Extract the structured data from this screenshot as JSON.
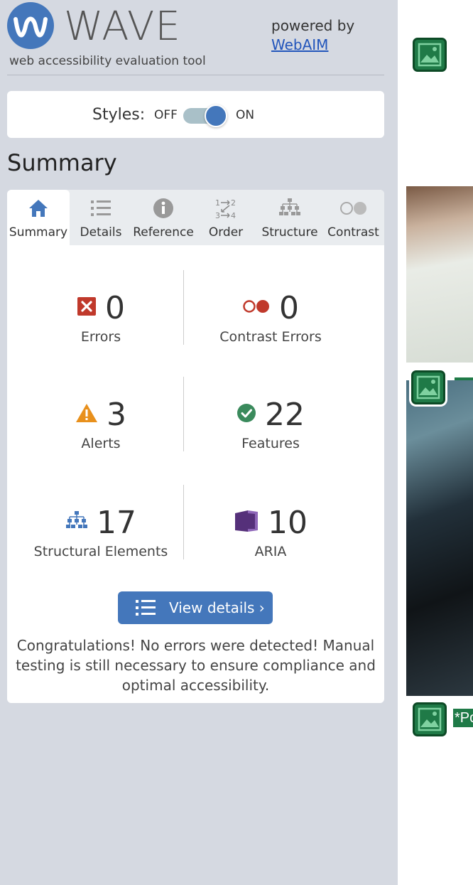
{
  "header": {
    "logo_text": "WAVE",
    "tagline": "web accessibility evaluation tool",
    "powered_by": "powered by",
    "webaim_link": "WebAIM"
  },
  "styles_toggle": {
    "label": "Styles:",
    "off": "OFF",
    "on": "ON",
    "state": "on"
  },
  "summary_heading": "Summary",
  "tabs": [
    {
      "label": "Summary",
      "icon": "home-icon",
      "active": true
    },
    {
      "label": "Details",
      "icon": "list-icon"
    },
    {
      "label": "Reference",
      "icon": "info-icon"
    },
    {
      "label": "Order",
      "icon": "order-icon"
    },
    {
      "label": "Structure",
      "icon": "structure-icon"
    },
    {
      "label": "Contrast",
      "icon": "contrast-icon"
    }
  ],
  "stats": {
    "errors": {
      "value": "0",
      "label": "Errors",
      "icon": "error-icon"
    },
    "contrast_errors": {
      "value": "0",
      "label": "Contrast Errors",
      "icon": "contrast-error-icon"
    },
    "alerts": {
      "value": "3",
      "label": "Alerts",
      "icon": "alert-icon"
    },
    "features": {
      "value": "22",
      "label": "Features",
      "icon": "feature-icon"
    },
    "structural": {
      "value": "17",
      "label": "Structural Elements",
      "icon": "structure-icon"
    },
    "aria": {
      "value": "10",
      "label": "ARIA",
      "icon": "aria-icon"
    }
  },
  "view_details_label": "View details ›",
  "congrats": "Congratulations! No errors were detected! Manual testing is still necessary to ensure compliance and optimal accessibility.",
  "preview": {
    "badge_label": "*Po"
  },
  "colors": {
    "brand_blue": "#4477bb",
    "error_red": "#c0392b",
    "alert_orange": "#e8901c",
    "feature_green": "#3a8a5c",
    "aria_purple": "#55307a",
    "sidebar_bg": "#d5d9e1"
  }
}
